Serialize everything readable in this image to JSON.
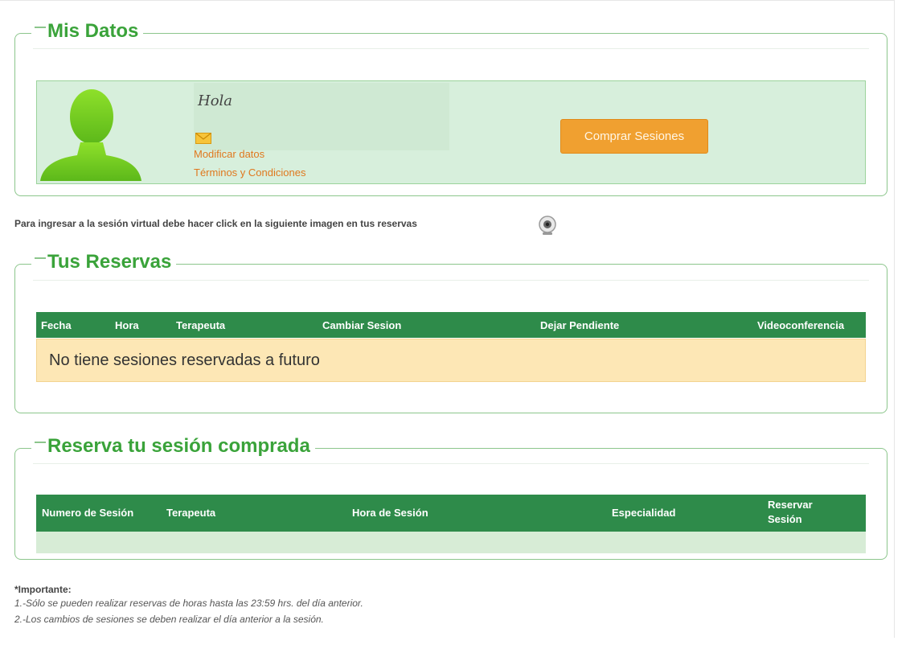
{
  "mis_datos": {
    "title": "Mis Datos",
    "greeting": "Hola",
    "modify_link": "Modificar datos",
    "terms_link": "Términos y Condiciones",
    "buy_button": "Comprar Sesiones"
  },
  "info_text": "Para ingresar a la sesión virtual debe hacer click en la siguiente imagen en tus reservas",
  "reservas": {
    "title": "Tus Reservas",
    "columns": [
      "Fecha",
      "Hora",
      "Terapeuta",
      "Cambiar Sesion",
      "Dejar Pendiente",
      "Videoconferencia"
    ],
    "empty_message": "No tiene sesiones reservadas a futuro"
  },
  "reserva_comprada": {
    "title": "Reserva tu sesión comprada",
    "columns": [
      "Numero de Sesión",
      "Terapeuta",
      "Hora de Sesión",
      "Especialidad",
      "Reservar Sesión"
    ]
  },
  "notes": {
    "heading": "*Importante:",
    "items": [
      "1.-Sólo se pueden realizar reservas de horas hasta las 23:59 hrs. del día anterior.",
      "2.-Los cambios de sesiones se deben realizar el día anterior a la sesión."
    ]
  },
  "colors": {
    "accent_green": "#3aa33a",
    "table_header": "#2e8b4a",
    "button_orange": "#f0a030",
    "link_orange": "#e0781e"
  },
  "icons": [
    "user-avatar-icon",
    "mail-icon",
    "webcam-icon"
  ]
}
